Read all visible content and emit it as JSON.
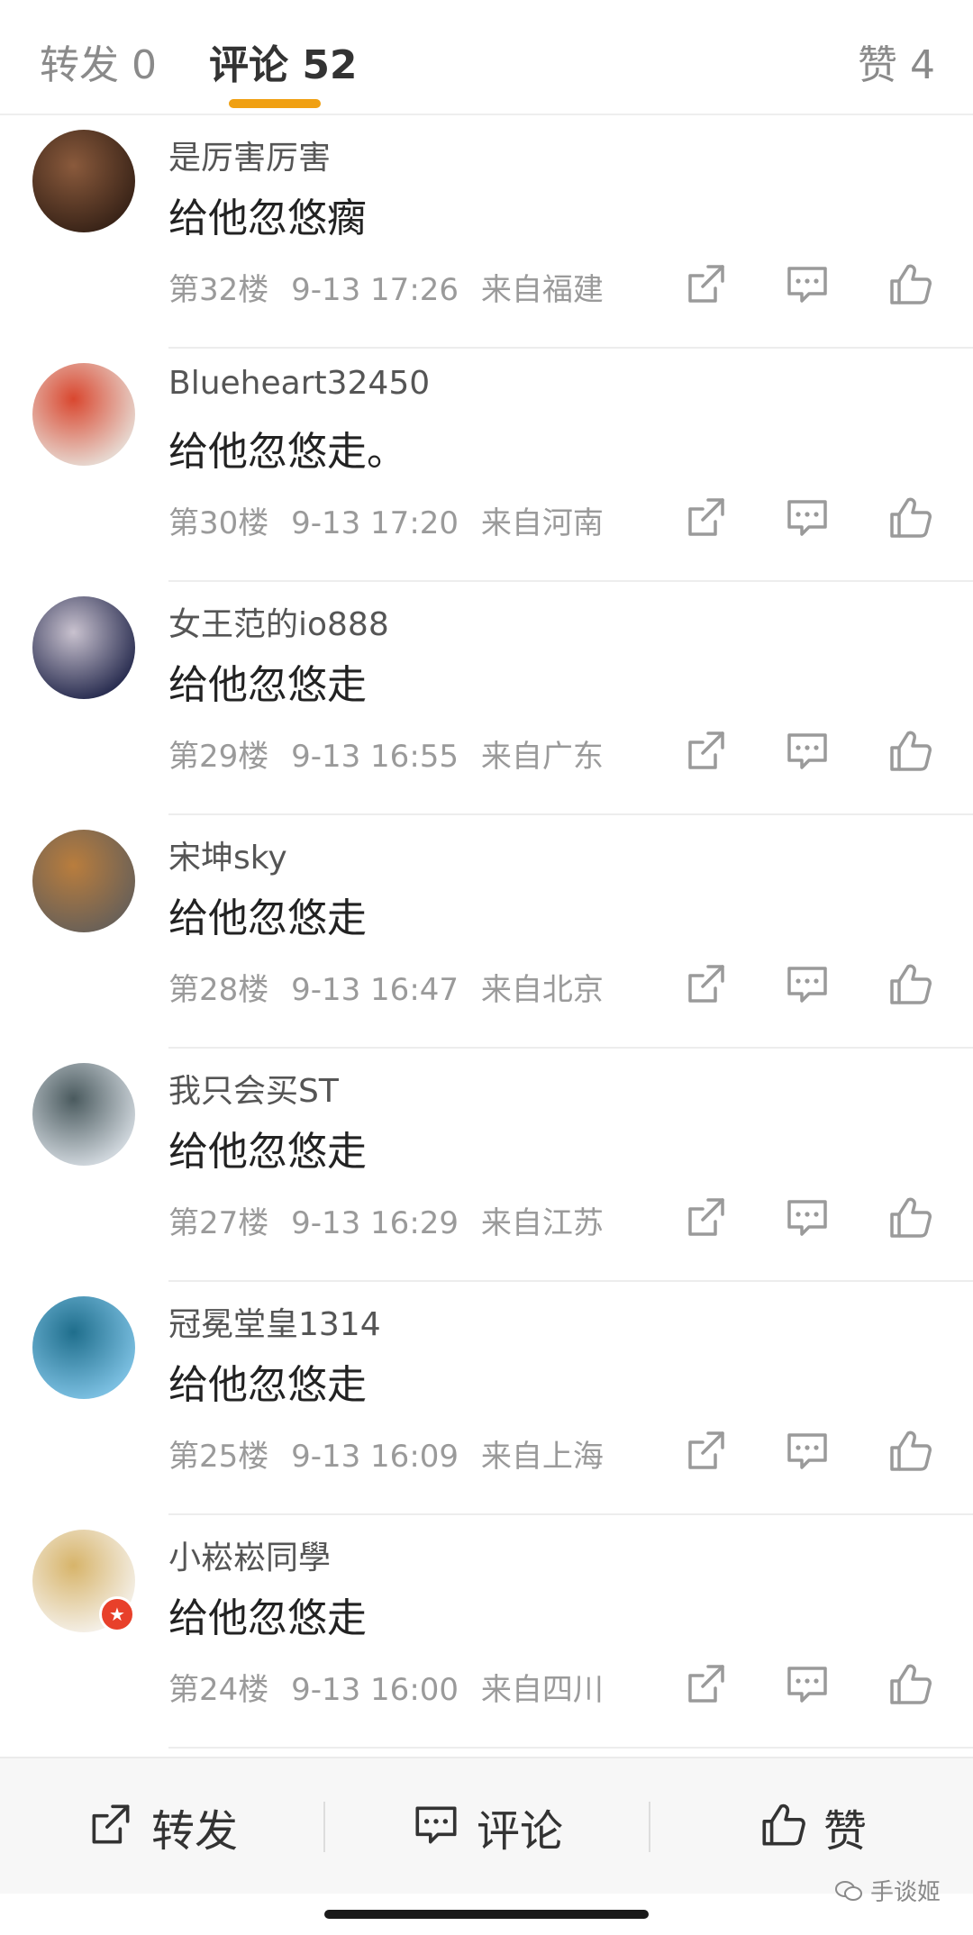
{
  "tabs": {
    "repost": "转发 0",
    "comments": "评论 52",
    "likes": "赞 4"
  },
  "comments": [
    {
      "username": "是厉害厉害",
      "text": "给他忽悠瘸",
      "floor": "第32楼",
      "time": "9-13 17:26",
      "location": "来自福建",
      "avatar_colors": [
        "#3a2418",
        "#8a5a3c"
      ]
    },
    {
      "username": "Blueheart32450",
      "text": "给他忽悠走。",
      "floor": "第30楼",
      "time": "9-13 17:20",
      "location": "来自河南",
      "avatar_colors": [
        "#e7d7cf",
        "#d9472f"
      ]
    },
    {
      "username": "女王范的io888",
      "text": "给他忽悠走",
      "floor": "第29楼",
      "time": "9-13 16:55",
      "location": "来自广东",
      "avatar_colors": [
        "#2b2f52",
        "#c9c2cf"
      ]
    },
    {
      "username": "宋坤sky",
      "text": "给他忽悠走",
      "floor": "第28楼",
      "time": "9-13 16:47",
      "location": "来自北京",
      "avatar_colors": [
        "#6b6157",
        "#b97d3d"
      ]
    },
    {
      "username": "我只会买ST",
      "text": "给他忽悠走",
      "floor": "第27楼",
      "time": "9-13 16:29",
      "location": "来自江苏",
      "avatar_colors": [
        "#cfd6dc",
        "#4a5a5e"
      ]
    },
    {
      "username": "冠冕堂皇1314",
      "text": "给他忽悠走",
      "floor": "第25楼",
      "time": "9-13 16:09",
      "location": "来自上海",
      "avatar_colors": [
        "#7bbfe1",
        "#1f6e8c"
      ]
    },
    {
      "username": "小崧崧同學",
      "text": "给他忽悠走",
      "floor": "第24楼",
      "time": "9-13 16:00",
      "location": "来自四川",
      "avatar_colors": [
        "#f4efe6",
        "#d7b46a"
      ]
    }
  ],
  "bottom_bar": {
    "repost": "转发",
    "comment": "评论",
    "like": "赞"
  },
  "watermark": "手谈姬",
  "colors": {
    "accent": "#f0a012",
    "badge": "#e8402a"
  }
}
